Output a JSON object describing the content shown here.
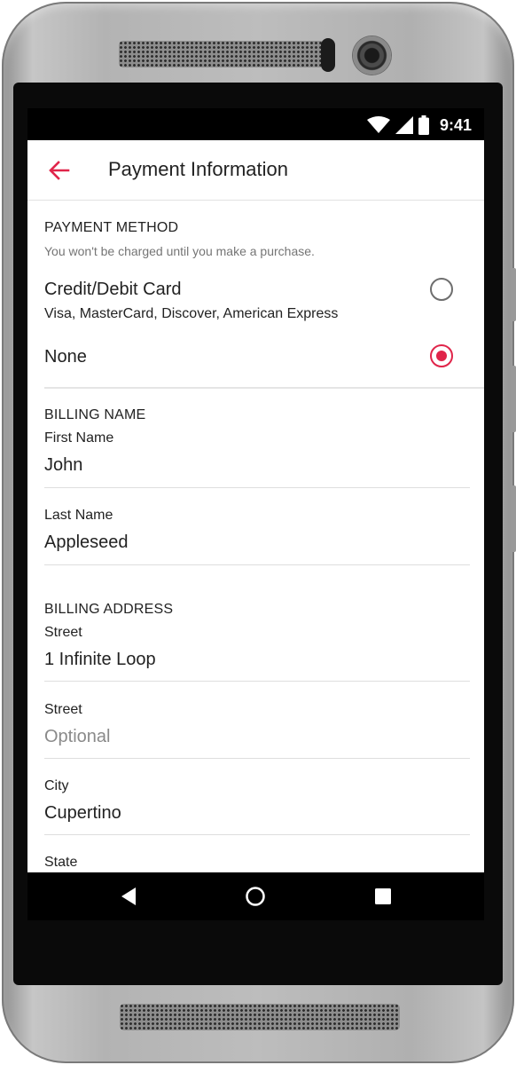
{
  "status_bar": {
    "time": "9:41",
    "icons": [
      "wifi-icon",
      "cell-signal-icon",
      "battery-icon"
    ]
  },
  "app_bar": {
    "back_icon": "arrow-left-icon",
    "title": "Payment Information"
  },
  "payment_method": {
    "title": "PAYMENT METHOD",
    "helper": "You won't be charged until you make a purchase.",
    "options": [
      {
        "label": "Credit/Debit Card",
        "sublabel": "Visa, MasterCard, Discover, American Express",
        "selected": false
      },
      {
        "label": "None",
        "selected": true
      }
    ]
  },
  "billing_name": {
    "title": "BILLING NAME",
    "fields": [
      {
        "label": "First Name",
        "value": "John"
      },
      {
        "label": "Last Name",
        "value": "Appleseed"
      }
    ]
  },
  "billing_address": {
    "title": "BILLING ADDRESS",
    "fields": [
      {
        "label": "Street",
        "value": "1 Infinite Loop"
      },
      {
        "label": "Street",
        "value": "",
        "placeholder": "Optional"
      },
      {
        "label": "City",
        "value": "Cupertino"
      },
      {
        "label": "State",
        "value": ""
      }
    ]
  },
  "nav_bar": {
    "icons": [
      "back-triangle-icon",
      "home-circle-icon",
      "recents-square-icon"
    ]
  },
  "colors": {
    "accent": "#e0254a",
    "text": "#222222",
    "helper": "#757575",
    "divider": "#e2e2e2"
  }
}
